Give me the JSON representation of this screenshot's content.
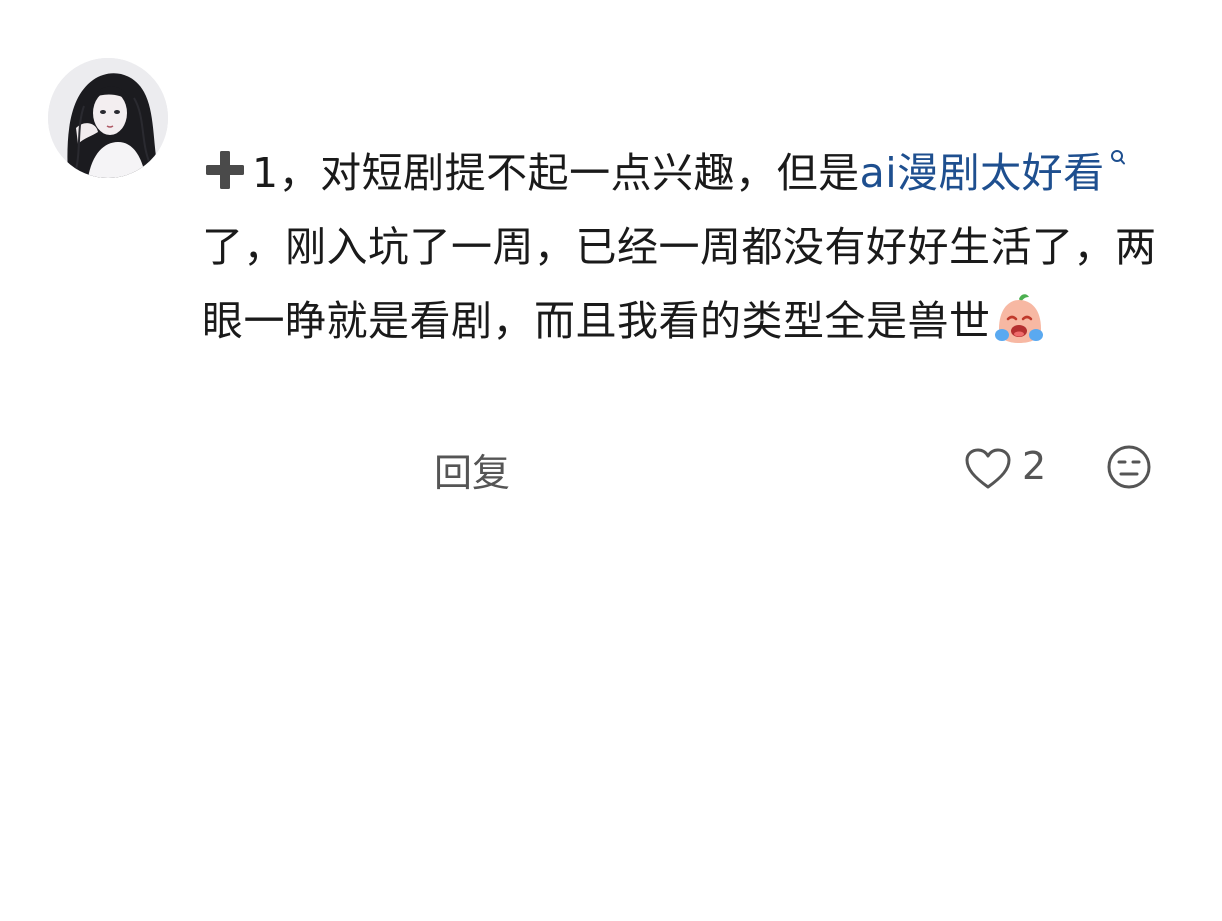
{
  "comment": {
    "avatar": "avatar-image",
    "text": {
      "prefix_icon": "plus-icon",
      "part1": "1，对短剧提不起一点兴趣，但是",
      "link": "ai漫剧太好看",
      "search_icon": "search-icon",
      "part2": "了，刚入坑了一周，已经一周都没有好好生活了，两眼一睁就是看剧，而且我看的类型全是兽世",
      "suffix_icon": "crying-emoji-icon"
    },
    "actions": {
      "reply_label": "回复",
      "like_icon": "heart-icon",
      "like_count": "2",
      "react_icon": "neutral-face-icon"
    }
  },
  "colors": {
    "link": "#1e4f8f",
    "text": "#1a1a1a",
    "secondary": "#555555",
    "plus": "#4a4a4a"
  }
}
